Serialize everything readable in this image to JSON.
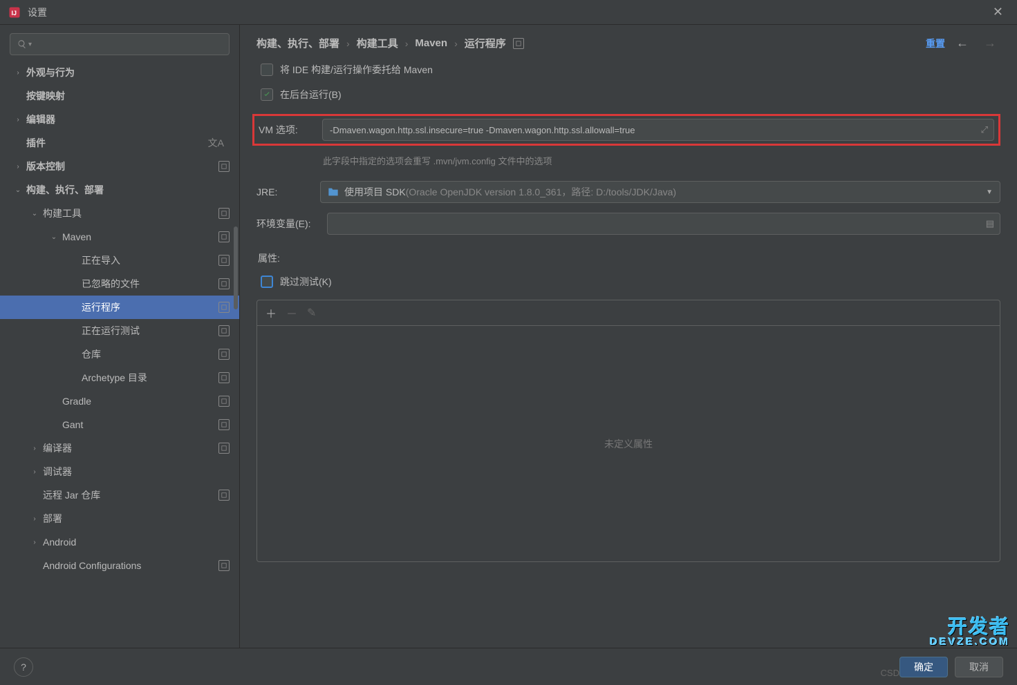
{
  "window": {
    "title": "设置"
  },
  "sidebar": {
    "items": [
      {
        "label": "外观与行为",
        "bold": true,
        "arrow": ">",
        "pad": 0
      },
      {
        "label": "按键映射",
        "bold": true,
        "arrow": "",
        "pad": 0
      },
      {
        "label": "编辑器",
        "bold": true,
        "arrow": ">",
        "pad": 0
      },
      {
        "label": "插件",
        "bold": true,
        "arrow": "",
        "pad": 0,
        "lang": true
      },
      {
        "label": "版本控制",
        "bold": true,
        "arrow": ">",
        "pad": 0,
        "badge": true
      },
      {
        "label": "构建、执行、部署",
        "bold": true,
        "arrow": "v",
        "pad": 0
      },
      {
        "label": "构建工具",
        "bold": false,
        "arrow": "v",
        "pad": 1,
        "badge": true
      },
      {
        "label": "Maven",
        "bold": false,
        "arrow": "v",
        "pad": 2,
        "badge": true
      },
      {
        "label": "正在导入",
        "bold": false,
        "arrow": "",
        "pad": 3,
        "badge": true
      },
      {
        "label": "已忽略的文件",
        "bold": false,
        "arrow": "",
        "pad": 3,
        "badge": true
      },
      {
        "label": "运行程序",
        "bold": false,
        "arrow": "",
        "pad": 3,
        "badge": true,
        "selected": true
      },
      {
        "label": "正在运行测试",
        "bold": false,
        "arrow": "",
        "pad": 3,
        "badge": true
      },
      {
        "label": "仓库",
        "bold": false,
        "arrow": "",
        "pad": 3,
        "badge": true
      },
      {
        "label": "Archetype 目录",
        "bold": false,
        "arrow": "",
        "pad": 3,
        "badge": true
      },
      {
        "label": "Gradle",
        "bold": false,
        "arrow": "",
        "pad": 2,
        "badge": true
      },
      {
        "label": "Gant",
        "bold": false,
        "arrow": "",
        "pad": 2,
        "badge": true
      },
      {
        "label": "编译器",
        "bold": false,
        "arrow": ">",
        "pad": 1,
        "badge": true
      },
      {
        "label": "调试器",
        "bold": false,
        "arrow": ">",
        "pad": 1
      },
      {
        "label": "远程 Jar 仓库",
        "bold": false,
        "arrow": "",
        "pad": 1,
        "badge": true
      },
      {
        "label": "部署",
        "bold": false,
        "arrow": ">",
        "pad": 1
      },
      {
        "label": "Android",
        "bold": false,
        "arrow": ">",
        "pad": 1
      },
      {
        "label": "Android Configurations",
        "bold": false,
        "arrow": "",
        "pad": 1,
        "badge": true
      }
    ]
  },
  "breadcrumb": {
    "items": [
      "构建、执行、部署",
      "构建工具",
      "Maven",
      "运行程序"
    ],
    "reset": "重置"
  },
  "form": {
    "delegate_label": "将 IDE 构建/运行操作委托给 Maven",
    "background_label": "在后台运行(B)",
    "vm_label": "VM 选项:",
    "vm_value": "-Dmaven.wagon.http.ssl.insecure=true -Dmaven.wagon.http.ssl.allowall=true",
    "vm_helper": "此字段中指定的选项会重写 .mvn/jvm.config 文件中的选项",
    "jre_label": "JRE:",
    "jre_prefix": "使用项目 SDK ",
    "jre_detail": "(Oracle OpenJDK version 1.8.0_361，路径: D:/tools/JDK/Java)",
    "env_label": "环境变量(E):",
    "attrs_label": "属性:",
    "skip_tests_label": "跳过测试(K)",
    "props_empty": "未定义属性"
  },
  "footer": {
    "ok": "确定",
    "cancel": "取消"
  },
  "watermark": {
    "main": "开发者",
    "sub": "DEVZE.COM"
  },
  "csdn": "CSD"
}
